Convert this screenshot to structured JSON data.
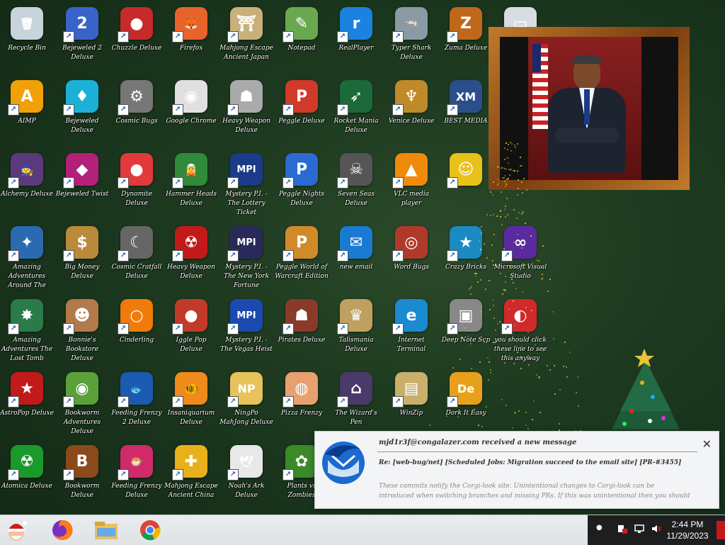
{
  "desktop_icons": [
    {
      "label": "Recycle Bin",
      "icon": "recycle-bin-icon",
      "color": "#c8d4dc",
      "glyph": "🗑",
      "shortcut": false
    },
    {
      "label": "Bejeweled 2 Deluxe",
      "icon": "bejeweled-2-icon",
      "color": "#3a63c9",
      "glyph": "2"
    },
    {
      "label": "Chuzzle Deluxe",
      "icon": "chuzzle-icon",
      "color": "#c62a2a",
      "glyph": "●"
    },
    {
      "label": "Firefox",
      "icon": "firefox-icon",
      "color": "#e8632b",
      "glyph": "🦊"
    },
    {
      "label": "Mahjong Escape Ancient Japan",
      "icon": "mahjong-escape-icon",
      "color": "#c9b07a",
      "glyph": "⛩"
    },
    {
      "label": "Notepad",
      "icon": "notepad-icon",
      "color": "#6aa84f",
      "glyph": "✎"
    },
    {
      "label": "RealPlayer",
      "icon": "realplayer-icon",
      "color": "#1a82e0",
      "glyph": "r"
    },
    {
      "label": "Typer Shark Deluxe",
      "icon": "typer-shark-icon",
      "color": "#8a9aa6",
      "glyph": "🦈"
    },
    {
      "label": "Zuma Deluxe",
      "icon": "zuma-icon",
      "color": "#c0671a",
      "glyph": "Z"
    },
    {
      "label": "",
      "icon": "window-icon",
      "color": "#d8dde2",
      "glyph": "▭",
      "shortcut": false
    },
    {
      "label": "AIMP",
      "icon": "aimp-icon",
      "color": "#f2a007",
      "glyph": "A"
    },
    {
      "label": "Bejeweled Deluxe",
      "icon": "bejeweled-icon",
      "color": "#1bb0d8",
      "glyph": "♦"
    },
    {
      "label": "Cosmic Bugs",
      "icon": "cosmic-bugs-icon",
      "color": "#777777",
      "glyph": "⚙"
    },
    {
      "label": "Google Chrome",
      "icon": "chrome-icon",
      "color": "#e0e0e0",
      "glyph": "◉"
    },
    {
      "label": "Heavy Weapon Deluxe",
      "icon": "heavy-weapon-icon",
      "color": "#aaaaaa",
      "glyph": "☗"
    },
    {
      "label": "Peggle Deluxe",
      "icon": "peggle-icon",
      "color": "#d13a2a",
      "glyph": "P"
    },
    {
      "label": "Rocket Mania Deluxe",
      "icon": "rocket-mania-icon",
      "color": "#1c6a3a",
      "glyph": "➶"
    },
    {
      "label": "Venice Deluxe",
      "icon": "venice-icon",
      "color": "#c08a2a",
      "glyph": "♆"
    },
    {
      "label": "BEST MEDIA",
      "icon": "xm-play-icon",
      "color": "#2b4f8a",
      "glyph": "XM"
    },
    {
      "label": "Alchemy Deluxe",
      "icon": "alchemy-icon",
      "color": "#5a3a7a",
      "glyph": "🧙"
    },
    {
      "label": "Bejeweled Twist",
      "icon": "bejeweled-twist-icon",
      "color": "#b3207a",
      "glyph": "◆"
    },
    {
      "label": "Dynomite Deluxe",
      "icon": "dynomite-icon",
      "color": "#e23a3a",
      "glyph": "●"
    },
    {
      "label": "Hammer Heads Deluxe",
      "icon": "hammer-heads-icon",
      "color": "#2f8a3a",
      "glyph": "🧝"
    },
    {
      "label": "Mystery P.I. - The Lottery Ticket",
      "icon": "mystery-pi-icon",
      "color": "#1a3a8a",
      "glyph": "MPI"
    },
    {
      "label": "Peggle Nights Deluxe",
      "icon": "peggle-nights-icon",
      "color": "#2a6ad1",
      "glyph": "P"
    },
    {
      "label": "Seven Seas Deluxe",
      "icon": "seven-seas-icon",
      "color": "#555555",
      "glyph": "☠"
    },
    {
      "label": "VLC media player",
      "icon": "vlc-icon",
      "color": "#f08a0a",
      "glyph": "▲"
    },
    {
      "label": "",
      "icon": "smiley-icon",
      "color": "#e8c21a",
      "glyph": "☺"
    },
    {
      "label": "Amazing Adventures Around The World",
      "icon": "amazing-adventures-icon",
      "color": "#2a6ab0",
      "glyph": "✦"
    },
    {
      "label": "Big Money Deluxe",
      "icon": "big-money-icon",
      "color": "#b98a3a",
      "glyph": "$"
    },
    {
      "label": "Cosmic Cratfall Deluxe",
      "icon": "crescent-icon",
      "color": "#666666",
      "glyph": "☾"
    },
    {
      "label": "Heavy Weapon Deluxe",
      "icon": "radiation-icon",
      "color": "#c21a1a",
      "glyph": "☢"
    },
    {
      "label": "Mystery P.I. - The New York Fortune",
      "icon": "mystery-pi-ny-icon",
      "color": "#2a2a5a",
      "glyph": "MPI"
    },
    {
      "label": "Peggle World of Warcraft Edition",
      "icon": "peggle-wow-icon",
      "color": "#d18a2a",
      "glyph": "P"
    },
    {
      "label": "new email",
      "icon": "thunderbird-icon",
      "color": "#1a7ad1",
      "glyph": "✉"
    },
    {
      "label": "Word Bugs",
      "icon": "porthole-icon",
      "color": "#b03a2a",
      "glyph": "◎"
    },
    {
      "label": "Crazy Bricks",
      "icon": "star-tile-icon",
      "color": "#1a8ac1",
      "glyph": "★"
    },
    {
      "label": "Microsoft Visual Studio",
      "icon": "visual-studio-icon",
      "color": "#5a2aa1",
      "glyph": "∞"
    },
    {
      "label": "Amazing Adventures The Lost Tomb",
      "icon": "lost-tomb-icon",
      "color": "#2a7a4a",
      "glyph": "✸"
    },
    {
      "label": "Bonnie's Bookstore Deluxe",
      "icon": "bonnie-icon",
      "color": "#b07a4a",
      "glyph": "☻"
    },
    {
      "label": "Cinderling",
      "icon": "ring-icon",
      "color": "#f07a0a",
      "glyph": "○"
    },
    {
      "label": "Iggle Pop Deluxe",
      "icon": "iggle-pop-icon",
      "color": "#c23a2a",
      "glyph": "●"
    },
    {
      "label": "Mystery P.I. - The Vegas Heist",
      "icon": "mystery-pi-vegas-icon",
      "color": "#1a4ab0",
      "glyph": "MPI"
    },
    {
      "label": "Pirates Deluxe",
      "icon": "pirate-icon",
      "color": "#8a3a2a",
      "glyph": "☗"
    },
    {
      "label": "Talismania Deluxe",
      "icon": "talismania-icon",
      "color": "#c0a060",
      "glyph": "♛"
    },
    {
      "label": "Internet Terminal",
      "icon": "edge-icon",
      "color": "#1a8ad1",
      "glyph": "e"
    },
    {
      "label": "Deep Note Scp",
      "icon": "stack-icon",
      "color": "#888888",
      "glyph": "▣"
    },
    {
      "label": "you should click these line to see this anyway",
      "icon": "red-dragon-icon",
      "color": "#d12a2a",
      "glyph": "◐"
    },
    {
      "label": "AstroPop Deluxe",
      "icon": "astropop-icon",
      "color": "#c21a1a",
      "glyph": "★"
    },
    {
      "label": "Bookworm Adventures Deluxe",
      "icon": "bookworm-adv-icon",
      "color": "#5aa13a",
      "glyph": "◉"
    },
    {
      "label": "Feeding Frenzy 2 Deluxe",
      "icon": "feeding-frenzy-2-icon",
      "color": "#1a5ab0",
      "glyph": "🐟"
    },
    {
      "label": "Insaniquarium Deluxe",
      "icon": "goldfish-icon",
      "color": "#f08a1a",
      "glyph": "🐠"
    },
    {
      "label": "NingPo MahJong Deluxe",
      "icon": "ningpo-icon",
      "color": "#e8c25a",
      "glyph": "NP"
    },
    {
      "label": "Pizza Frenzy",
      "icon": "pizza-icon",
      "color": "#e8a070",
      "glyph": "◍"
    },
    {
      "label": "The Wizard's Pen",
      "icon": "wizard-house-icon",
      "color": "#4a3a6a",
      "glyph": "⌂"
    },
    {
      "label": "WinZip",
      "icon": "winzip-icon",
      "color": "#c8b06a",
      "glyph": "▤"
    },
    {
      "label": "Dork It Easy",
      "icon": "de-icon",
      "color": "#e8a01a",
      "glyph": "De"
    },
    {
      "label": "Atomica Deluxe",
      "icon": "atomica-icon",
      "color": "#1a9a2a",
      "glyph": "☢"
    },
    {
      "label": "Bookworm Deluxe",
      "icon": "bookworm-icon",
      "color": "#8a4a1a",
      "glyph": "B"
    },
    {
      "label": "Feeding Frenzy Deluxe",
      "icon": "feeding-frenzy-icon",
      "color": "#d12a6a",
      "glyph": "🐡"
    },
    {
      "label": "Mahjong Escape Ancient China",
      "icon": "mahjong-china-icon",
      "color": "#e8b01a",
      "glyph": "✚"
    },
    {
      "label": "Noah's Ark Deluxe",
      "icon": "dove-icon",
      "color": "#e8e8e8",
      "glyph": "🕊"
    },
    {
      "label": "Plants vs Zombies",
      "icon": "plants-icon",
      "color": "#3a8a2a",
      "glyph": "✿"
    }
  ],
  "frame": {
    "photo_name": "portrait-photo"
  },
  "notification": {
    "app": "Thunderbird",
    "title": "mjd1r3f@congalazer.com received a new message",
    "subject": "Re: [web-bug/net] [Scheduled Jobs: Migration succeed to the email site] [PR-#3455]",
    "body": "These commits notify the Corgi-look site. Unintentional changes to Corgi-look can be introduced when switching branches and missing PRs. If this was unintentional then you should revert the changes before the PR is merged. Otherwise, you can ign",
    "close_label": "✕"
  },
  "taskbar": {
    "start_icon": "santa-start-icon",
    "pinned": [
      {
        "name": "firefox-taskbar-button",
        "color": "#e8632b"
      },
      {
        "name": "file-explorer-taskbar-button",
        "color": "#e8c25a"
      },
      {
        "name": "chrome-taskbar-button",
        "color": "#1a9a4a"
      }
    ],
    "clock_time": "2:44 PM",
    "clock_date": "11/29/2023"
  }
}
